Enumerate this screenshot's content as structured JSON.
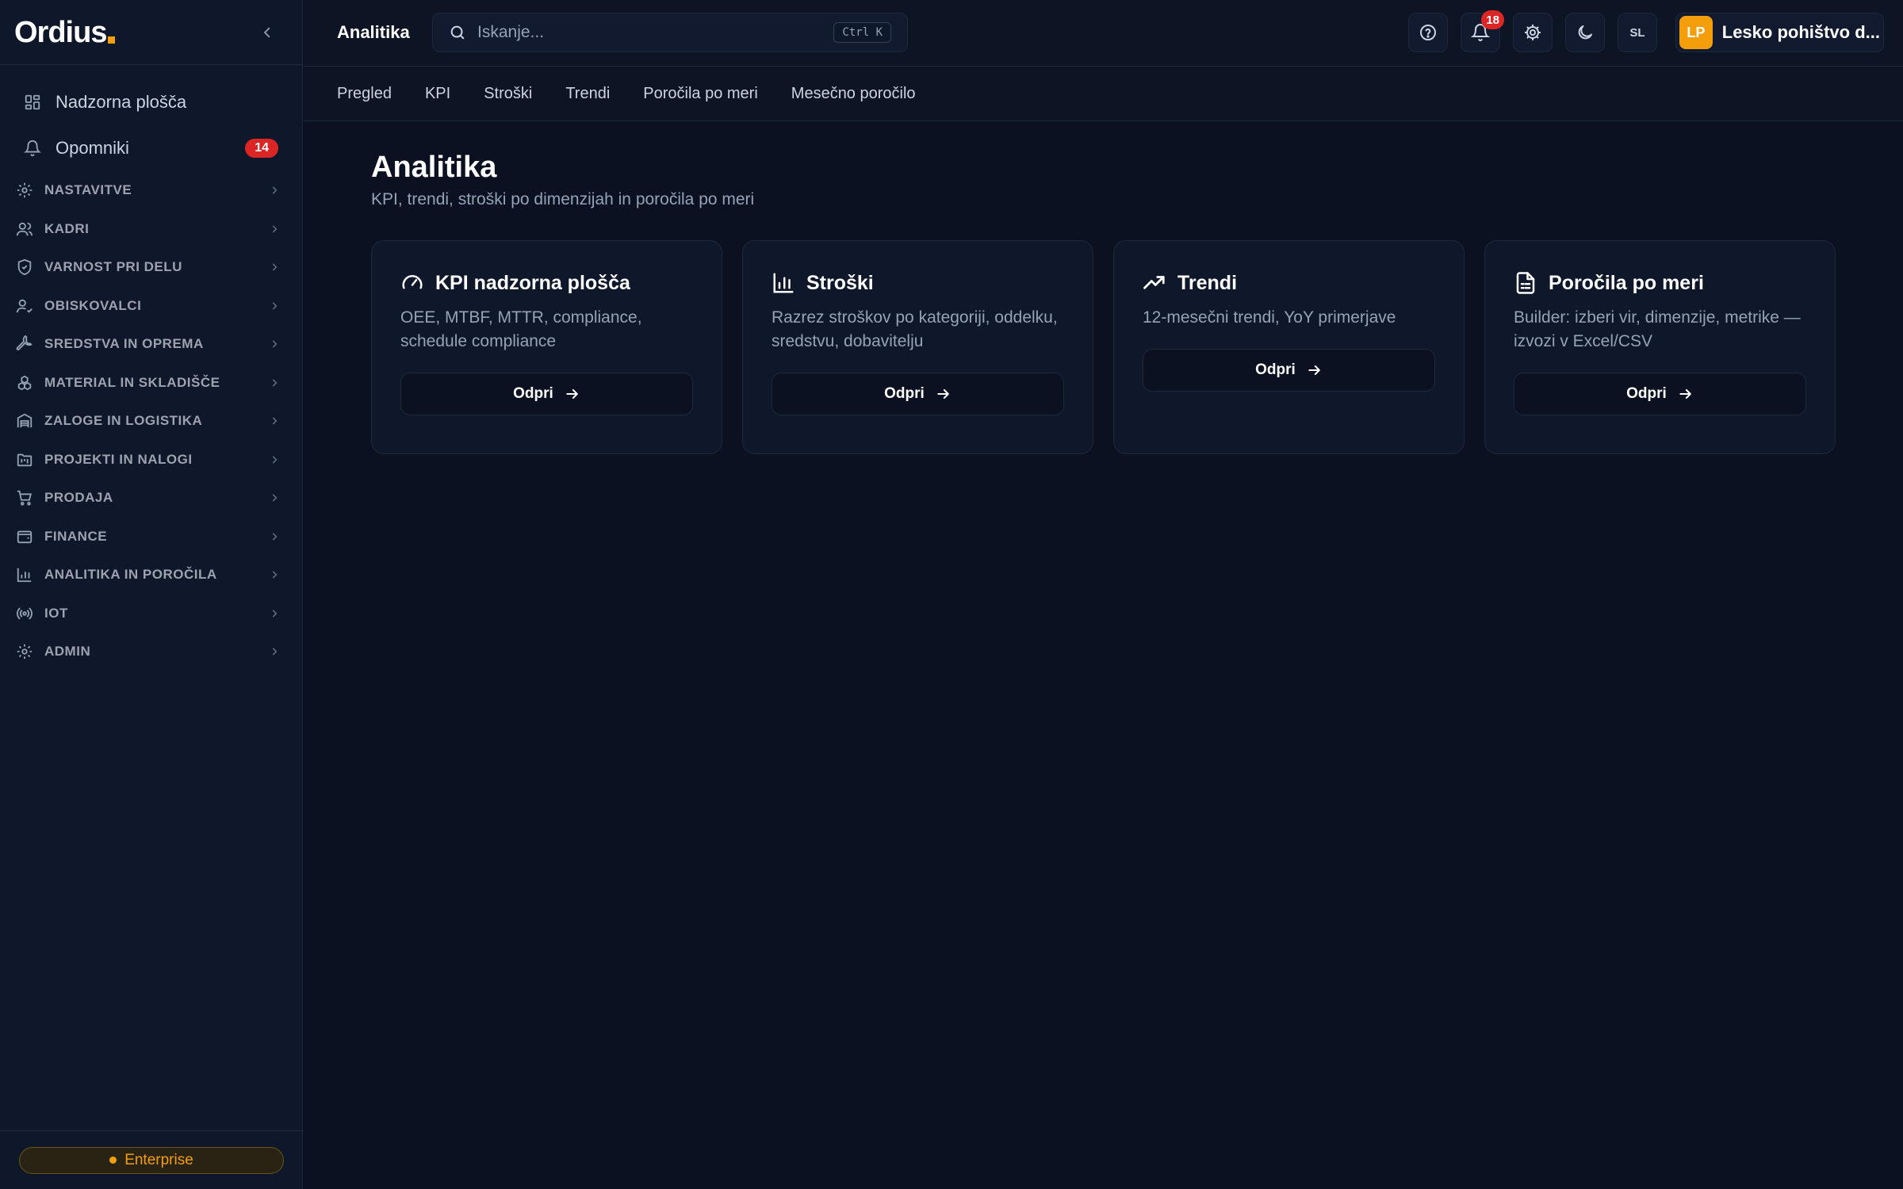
{
  "sidebar": {
    "logo": "Ordius",
    "top_items": [
      {
        "label": "Nadzorna plošča",
        "icon": "dashboard-grid-icon"
      },
      {
        "label": "Opomniki",
        "icon": "bell-icon",
        "badge": "14"
      }
    ],
    "sections": [
      {
        "label": "NASTAVITVE",
        "icon": "gear-icon"
      },
      {
        "label": "KADRI",
        "icon": "users-icon"
      },
      {
        "label": "VARNOST PRI DELU",
        "icon": "shield-check-icon"
      },
      {
        "label": "OBISKOVALCI",
        "icon": "user-check-icon"
      },
      {
        "label": "SREDSTVA IN OPREMA",
        "icon": "wrench-icon"
      },
      {
        "label": "MATERIAL IN SKLADIŠČE",
        "icon": "boxes-icon"
      },
      {
        "label": "ZALOGE IN LOGISTIKA",
        "icon": "warehouse-icon"
      },
      {
        "label": "PROJEKTI IN NALOGI",
        "icon": "folder-kanban-icon"
      },
      {
        "label": "PRODAJA",
        "icon": "cart-icon"
      },
      {
        "label": "FINANCE",
        "icon": "wallet-icon"
      },
      {
        "label": "ANALITIKA IN POROČILA",
        "icon": "bar-chart-icon"
      },
      {
        "label": "IOT",
        "icon": "radio-icon"
      },
      {
        "label": "ADMIN",
        "icon": "gear-icon"
      }
    ],
    "plan": "Enterprise"
  },
  "topbar": {
    "title": "Analitika",
    "search_placeholder": "Iskanje...",
    "search_shortcut": "Ctrl K",
    "notification_count": "18",
    "language": "SL",
    "account_initials": "LP",
    "account_name": "Lesko pohištvo d..."
  },
  "tabs": [
    "Pregled",
    "KPI",
    "Stroški",
    "Trendi",
    "Poročila po meri",
    "Mesečno poročilo"
  ],
  "main": {
    "title": "Analitika",
    "subtitle": "KPI, trendi, stroški po dimenzijah in poročila po meri",
    "cards": [
      {
        "title": "KPI nadzorna plošča",
        "icon": "gauge-icon",
        "description": "OEE, MTBF, MTTR, compliance, schedule compliance",
        "button": "Odpri"
      },
      {
        "title": "Stroški",
        "icon": "bar-chart-icon",
        "description": "Razrez stroškov po kategoriji, oddelku, sredstvu, dobavitelju",
        "button": "Odpri"
      },
      {
        "title": "Trendi",
        "icon": "trending-up-icon",
        "description": "12-mesečni trendi, YoY primerjave",
        "button": "Odpri"
      },
      {
        "title": "Poročila po meri",
        "icon": "file-text-icon",
        "description": "Builder: izberi vir, dimenzije, metrike — izvozi v Excel/CSV",
        "button": "Odpri"
      }
    ]
  },
  "colors": {
    "background": "#0b1120",
    "sidebar": "#0f172a",
    "accent": "#f59e0b",
    "danger": "#dc2626"
  }
}
